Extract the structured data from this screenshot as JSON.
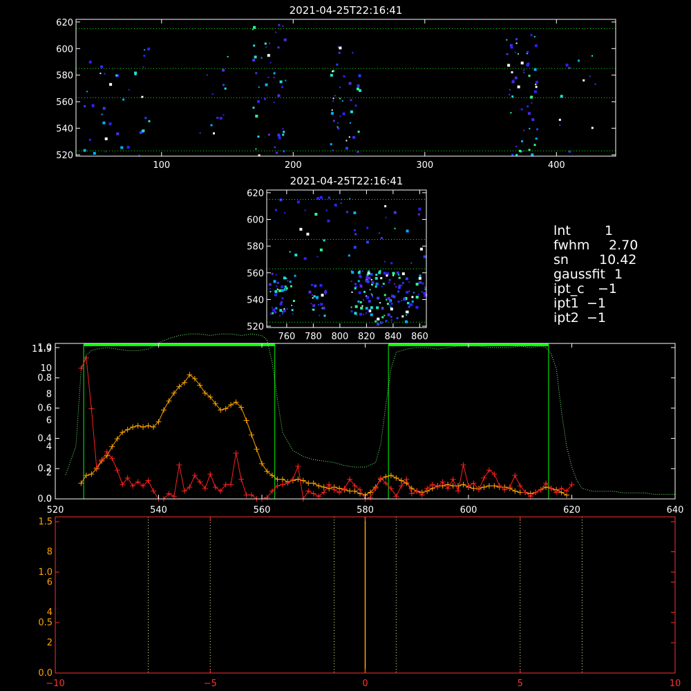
{
  "colors": {
    "background": "#000000",
    "axis": "#ffffff",
    "grid": "#00ff00",
    "series_red": "#ff2020",
    "series_orange": "#ffa500",
    "series_green_dotted": "#7cff7c",
    "window_green": "#00ff00",
    "spec_axis": "#ff3030",
    "spec_tick_labels_left": "#ffa500",
    "spec_center_line": "#ffa500",
    "spec_dotted": "#ffff88"
  },
  "params": {
    "lines": [
      {
        "key": "lnt",
        "label": "lnt",
        "value": "1"
      },
      {
        "key": "fwhm",
        "label": "fwhm",
        "value": "2.70"
      },
      {
        "key": "sn",
        "label": "sn",
        "value": "10.42"
      },
      {
        "key": "gaussfit",
        "label": "gaussfit",
        "value": "1"
      },
      {
        "key": "ipt_c",
        "label": "ipt_c",
        "value": "−1"
      },
      {
        "key": "ipt1",
        "label": "ipt1",
        "value": "−1"
      },
      {
        "key": "ipt2",
        "label": "ipt2",
        "value": "−1"
      }
    ]
  },
  "chart_data": [
    {
      "id": "image-full",
      "type": "heatmap",
      "title": "2021-04-25T22:16:41",
      "xlim": [
        35,
        445
      ],
      "ylim": [
        519,
        622
      ],
      "xticks": [
        100,
        200,
        300,
        400
      ],
      "yticks": [
        520,
        540,
        560,
        580,
        600,
        620
      ],
      "hlines": [
        523,
        563,
        585,
        615
      ],
      "hline_style": "dotted-green",
      "clusters": [
        {
          "x": [
            40,
            90
          ],
          "y": [
            520,
            605
          ],
          "n": 40
        },
        {
          "x": [
            120,
            150
          ],
          "y": [
            525,
            600
          ],
          "n": 12
        },
        {
          "x": [
            168,
            195
          ],
          "y": [
            520,
            620
          ],
          "n": 45
        },
        {
          "x": [
            228,
            250
          ],
          "y": [
            520,
            605
          ],
          "n": 40
        },
        {
          "x": [
            360,
            385
          ],
          "y": [
            520,
            616
          ],
          "n": 55
        },
        {
          "x": [
            395,
            430
          ],
          "y": [
            522,
            612
          ],
          "n": 12
        }
      ]
    },
    {
      "id": "image-zoom",
      "type": "heatmap",
      "title": "2021-04-25T22:16:41",
      "xlim": [
        745,
        865
      ],
      "ylim": [
        519,
        622
      ],
      "xticks": [
        760,
        780,
        800,
        820,
        840,
        860
      ],
      "yticks": [
        520,
        540,
        560,
        580,
        600,
        620
      ],
      "hlines": [
        523,
        563,
        585,
        615
      ],
      "hline_style": "dotted-green",
      "clusters": [
        {
          "x": [
            746,
            766
          ],
          "y": [
            528,
            560
          ],
          "n": 45
        },
        {
          "x": [
            776,
            790
          ],
          "y": [
            528,
            552
          ],
          "n": 25
        },
        {
          "x": [
            808,
            824
          ],
          "y": [
            525,
            562
          ],
          "n": 60
        },
        {
          "x": [
            826,
            850
          ],
          "y": [
            522,
            562
          ],
          "n": 75
        },
        {
          "x": [
            850,
            864
          ],
          "y": [
            535,
            560
          ],
          "n": 25
        },
        {
          "x": [
            750,
            864
          ],
          "y": [
            565,
            620
          ],
          "n": 45
        }
      ]
    },
    {
      "id": "profile",
      "type": "line",
      "title": "",
      "xlim": [
        520,
        640
      ],
      "xticks": [
        520,
        540,
        560,
        580,
        600,
        620,
        640
      ],
      "left_axis": {
        "ylim": [
          0,
          1.0
        ],
        "ticks": [
          "0.0",
          "0.2",
          "0.4",
          "0.6",
          "0.8",
          "1.0"
        ]
      },
      "left_axis_overlay": {
        "ylim": [
          0,
          11.9
        ],
        "ticks": [
          "0",
          "2",
          "4",
          "6",
          "8",
          "10"
        ],
        "top_label": "11.9"
      },
      "right_axis": {
        "ylim": [
          0,
          1.0
        ],
        "ticks": [
          0,
          0.2,
          0.4,
          0.6,
          0.8,
          1.0
        ]
      },
      "windows": [
        {
          "x0": 525.5,
          "x1": 562.5
        },
        {
          "x0": 584.5,
          "x1": 615.5
        }
      ],
      "series": [
        {
          "role": "green-dotted",
          "x": [
            522,
            524,
            525,
            526,
            527,
            528,
            530,
            532,
            534,
            536,
            538,
            540,
            542,
            544,
            546,
            548,
            550,
            552,
            554,
            556,
            558,
            560,
            561,
            562,
            563,
            564,
            566,
            568,
            570,
            572,
            574,
            576,
            578,
            580,
            582,
            583,
            584,
            585,
            586,
            588,
            590,
            592,
            594,
            596,
            598,
            600,
            602,
            604,
            606,
            608,
            610,
            612,
            614,
            615,
            616,
            617,
            618,
            619,
            620,
            621,
            622,
            624,
            626,
            628,
            630,
            632,
            634,
            636,
            638,
            640
          ],
          "y": [
            0.16,
            0.35,
            0.85,
            0.95,
            0.98,
            0.99,
            1.0,
            0.99,
            0.98,
            0.98,
            0.99,
            1.03,
            1.06,
            1.08,
            1.09,
            1.09,
            1.08,
            1.09,
            1.09,
            1.08,
            1.09,
            1.08,
            1.05,
            0.9,
            0.66,
            0.44,
            0.32,
            0.28,
            0.26,
            0.25,
            0.24,
            0.22,
            0.21,
            0.21,
            0.24,
            0.36,
            0.62,
            0.86,
            0.97,
            0.99,
            1.0,
            1.0,
            0.99,
            1.0,
            1.01,
            1.01,
            1.01,
            1.0,
            1.0,
            1.0,
            1.01,
            1.0,
            1.01,
            1.0,
            0.96,
            0.86,
            0.58,
            0.35,
            0.21,
            0.12,
            0.07,
            0.05,
            0.05,
            0.05,
            0.04,
            0.04,
            0.04,
            0.03,
            0.03,
            0.03
          ]
        },
        {
          "role": "orange",
          "x": [
            525,
            526,
            527,
            528,
            529,
            530,
            531,
            532,
            533,
            534,
            535,
            536,
            537,
            538,
            539,
            540,
            541,
            542,
            543,
            544,
            545,
            546,
            547,
            548,
            549,
            550,
            551,
            552,
            553,
            554,
            555,
            556,
            557,
            558,
            559,
            560,
            561,
            562,
            563,
            564,
            565,
            566,
            567,
            568,
            569,
            570,
            571,
            572,
            573,
            574,
            575,
            576,
            577,
            578,
            579,
            580,
            581,
            582,
            583,
            584,
            585,
            586,
            587,
            588,
            589,
            590,
            591,
            592,
            593,
            594,
            595,
            596,
            597,
            598,
            599,
            600,
            601,
            602,
            603,
            604,
            605,
            606,
            607,
            608,
            609,
            610,
            611,
            612,
            613,
            614,
            615,
            616,
            617,
            618,
            619
          ],
          "y": [
            1.2,
            1.8,
            1.9,
            2.3,
            2.9,
            3.3,
            4.0,
            4.6,
            5.1,
            5.3,
            5.5,
            5.6,
            5.5,
            5.6,
            5.5,
            5.9,
            6.8,
            7.5,
            8.1,
            8.6,
            8.9,
            9.5,
            9.2,
            8.7,
            8.1,
            7.8,
            7.3,
            6.8,
            6.9,
            7.2,
            7.4,
            7.0,
            6.0,
            4.9,
            3.8,
            2.7,
            2.1,
            1.8,
            1.5,
            1.5,
            1.3,
            1.4,
            1.5,
            1.4,
            1.2,
            1.2,
            1.0,
            0.9,
            0.8,
            0.9,
            0.8,
            0.7,
            0.6,
            0.6,
            0.4,
            0.3,
            0.5,
            0.9,
            1.5,
            1.7,
            1.8,
            1.6,
            1.4,
            1.2,
            0.8,
            0.6,
            0.5,
            0.6,
            0.8,
            1.0,
            1.0,
            1.1,
            1.0,
            1.0,
            1.1,
            0.9,
            0.8,
            0.8,
            0.9,
            1.0,
            1.0,
            0.9,
            0.9,
            0.8,
            0.6,
            0.5,
            0.5,
            0.4,
            0.5,
            0.7,
            0.9,
            0.8,
            0.7,
            0.5,
            0.3
          ]
        },
        {
          "role": "red",
          "x": [
            525,
            526,
            527,
            528,
            529,
            530,
            531,
            532,
            533,
            534,
            535,
            536,
            537,
            538,
            539,
            540,
            541,
            542,
            543,
            544,
            545,
            546,
            547,
            548,
            549,
            550,
            551,
            552,
            553,
            554,
            555,
            556,
            557,
            558,
            559,
            560,
            561,
            562,
            563,
            564,
            565,
            566,
            567,
            568,
            569,
            570,
            571,
            572,
            573,
            574,
            575,
            576,
            577,
            578,
            579,
            580,
            581,
            582,
            583,
            584,
            585,
            586,
            587,
            588,
            589,
            590,
            591,
            592,
            593,
            594,
            595,
            596,
            597,
            598,
            599,
            600,
            601,
            602,
            603,
            604,
            605,
            606,
            607,
            608,
            609,
            610,
            611,
            612,
            613,
            614,
            615,
            616,
            617,
            618,
            619,
            620
          ],
          "y": [
            10.0,
            10.8,
            6.9,
            2.4,
            3.0,
            3.6,
            3.1,
            2.2,
            1.1,
            1.6,
            1.0,
            1.3,
            1.0,
            1.4,
            0.6,
            0.0,
            0.0,
            0.4,
            0.2,
            2.6,
            0.6,
            0.9,
            1.8,
            1.3,
            0.8,
            1.9,
            0.9,
            0.6,
            1.1,
            1.1,
            3.5,
            1.5,
            0.3,
            0.3,
            0.0,
            0.0,
            0.1,
            0.6,
            1.0,
            1.1,
            1.2,
            1.5,
            2.5,
            0.0,
            0.6,
            0.4,
            0.2,
            0.5,
            1.1,
            0.7,
            0.5,
            0.8,
            1.5,
            1.0,
            0.7,
            0.0,
            0.1,
            0.8,
            1.6,
            1.2,
            0.8,
            0.2,
            1.0,
            1.5,
            0.4,
            0.6,
            0.3,
            0.8,
            1.1,
            0.9,
            1.3,
            0.8,
            1.5,
            0.6,
            2.6,
            1.0,
            1.2,
            0.7,
            1.6,
            2.2,
            1.9,
            1.0,
            0.7,
            0.9,
            1.8,
            1.0,
            0.5,
            0.2,
            0.5,
            0.7,
            1.2,
            0.8,
            0.5,
            0.8,
            0.6,
            1.1
          ]
        }
      ]
    },
    {
      "id": "spectrum",
      "type": "line",
      "title": "",
      "xlim": [
        -10,
        10
      ],
      "xticks": [
        -10,
        -5,
        0,
        5,
        10
      ],
      "xtick_labels": [
        "−10",
        "−5",
        "0",
        "5",
        "10"
      ],
      "left_axis": {
        "ylim": [
          0,
          1.5
        ],
        "ticks": [
          "0.0",
          "0.5",
          "1.0",
          "1.5"
        ]
      },
      "left_axis_overlay": {
        "ticks": [
          "2",
          "4",
          "6",
          "8"
        ],
        "ylim": [
          0,
          10.3
        ]
      },
      "center_line_x": 0,
      "dotted_vlines": [
        -7,
        -5,
        -1,
        1,
        5,
        7
      ],
      "series": []
    }
  ]
}
